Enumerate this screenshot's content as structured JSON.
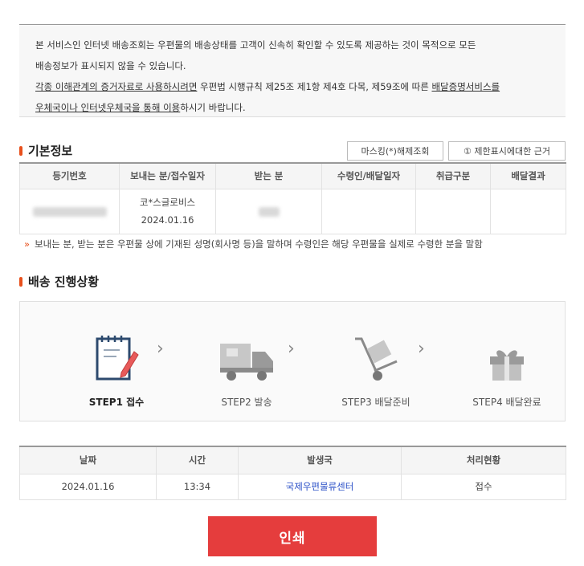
{
  "notice": {
    "line1": "본 서비스인 인터넷 배송조회는 우편물의 배송상태를 고객이 신속히 확인할 수 있도록 제공하는 것이 목적으로 모든",
    "line2": "배송정보가 표시되지 않을 수 있습니다.",
    "line3_u1": "각종 이해관계의 증거자료로 사용하시려면",
    "line3_mid": " 우편법 시행규칙 제25조 제1항 제4호 다목, 제59조에 따른 ",
    "line3_u2": "배달증명서비스를",
    "line4_u": "우체국이나 인터넷우체국을 통해 이용",
    "line4_end": "하시기 바랍니다."
  },
  "basic_info": {
    "title": "기본정보",
    "unmask_button": "마스킹(*)해제조회",
    "reason_button": "① 제한표시에대한 근거",
    "headers": [
      "등기번호",
      "보내는 분/접수일자",
      "받는 분",
      "수령인/배달일자",
      "취급구분",
      "배달결과"
    ],
    "sender_name": "코*스글로비스",
    "sender_date": "2024.01.16"
  },
  "footnote": "보내는 분, 받는 분은 우편물 상에 기재된 성명(회사명 등)을 말하며 수령인은 해당 우편물을 실제로 수령한 분을 말함",
  "progress": {
    "title": "배송 진행상황",
    "steps": [
      {
        "label": "STEP1 접수",
        "icon": "clipboard-icon",
        "active": true
      },
      {
        "label": "STEP2 발송",
        "icon": "truck-icon",
        "active": false
      },
      {
        "label": "STEP3 배달준비",
        "icon": "hand-cart-icon",
        "active": false
      },
      {
        "label": "STEP4 배달완료",
        "icon": "gift-box-icon",
        "active": false
      }
    ]
  },
  "history": {
    "headers": [
      "날짜",
      "시간",
      "발생국",
      "처리현황"
    ],
    "rows": [
      {
        "date": "2024.01.16",
        "time": "13:34",
        "office": "국제우편물류센터",
        "status": "접수"
      }
    ]
  },
  "print_button": "인쇄",
  "colors": {
    "accent": "#e8501c",
    "print": "#e53d3d",
    "link": "#2a4fc7"
  }
}
